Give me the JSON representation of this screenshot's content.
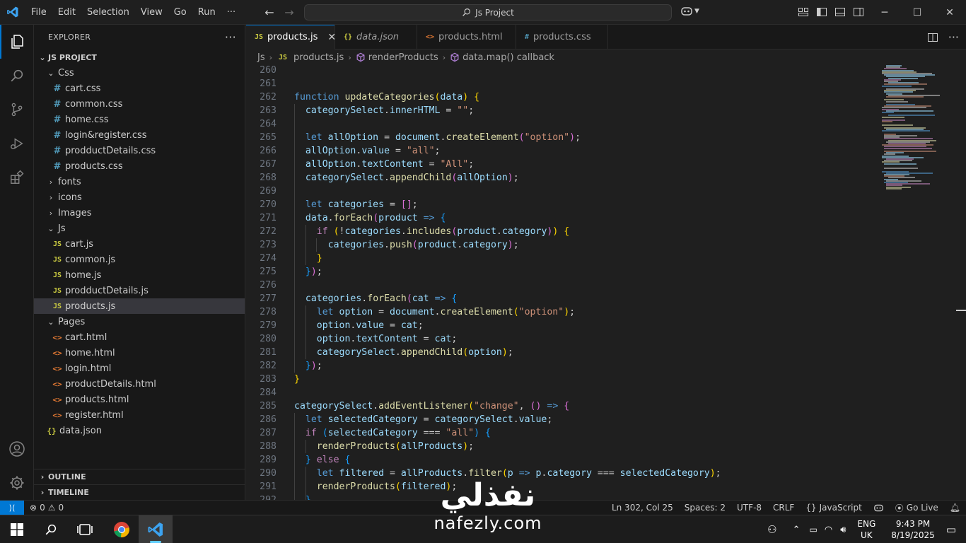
{
  "menu": [
    "File",
    "Edit",
    "Selection",
    "View",
    "Go",
    "Run",
    "···"
  ],
  "command_center": {
    "label": "Js Project"
  },
  "explorer": {
    "header": "EXPLORER",
    "project": "JS PROJECT",
    "tree": [
      {
        "label": "Css",
        "type": "folder-open",
        "depth": 1
      },
      {
        "label": "cart.css",
        "type": "css",
        "depth": 2
      },
      {
        "label": "common.css",
        "type": "css",
        "depth": 2
      },
      {
        "label": "home.css",
        "type": "css",
        "depth": 2
      },
      {
        "label": "login&register.css",
        "type": "css",
        "depth": 2
      },
      {
        "label": "prodductDetails.css",
        "type": "css",
        "depth": 2
      },
      {
        "label": "products.css",
        "type": "css",
        "depth": 2
      },
      {
        "label": "fonts",
        "type": "folder",
        "depth": 1
      },
      {
        "label": "icons",
        "type": "folder",
        "depth": 1
      },
      {
        "label": "Images",
        "type": "folder",
        "depth": 1
      },
      {
        "label": "Js",
        "type": "folder-open",
        "depth": 1
      },
      {
        "label": "cart.js",
        "type": "js",
        "depth": 2
      },
      {
        "label": "common.js",
        "type": "js",
        "depth": 2
      },
      {
        "label": "home.js",
        "type": "js",
        "depth": 2
      },
      {
        "label": "prodductDetails.js",
        "type": "js",
        "depth": 2
      },
      {
        "label": "products.js",
        "type": "js",
        "depth": 2,
        "selected": true
      },
      {
        "label": "Pages",
        "type": "folder-open",
        "depth": 1
      },
      {
        "label": "cart.html",
        "type": "html",
        "depth": 2
      },
      {
        "label": "home.html",
        "type": "html",
        "depth": 2
      },
      {
        "label": "login.html",
        "type": "html",
        "depth": 2
      },
      {
        "label": "productDetails.html",
        "type": "html",
        "depth": 2
      },
      {
        "label": "products.html",
        "type": "html",
        "depth": 2
      },
      {
        "label": "register.html",
        "type": "html",
        "depth": 2
      },
      {
        "label": "data.json",
        "type": "json",
        "depth": 1
      }
    ],
    "outline": "OUTLINE",
    "timeline": "TIMELINE"
  },
  "tabs": [
    {
      "label": "products.js",
      "icon": "JS",
      "kind": "js",
      "active": true
    },
    {
      "label": "data.json",
      "icon": "{}",
      "kind": "json",
      "italic": true
    },
    {
      "label": "products.html",
      "icon": "<>",
      "kind": "html"
    },
    {
      "label": "products.css",
      "icon": "#",
      "kind": "css"
    }
  ],
  "breadcrumbs": {
    "folder": "Js",
    "file": "products.js",
    "symbol1": "renderProducts",
    "symbol2": "data.map() callback"
  },
  "code": {
    "first_line": 260,
    "lines": [
      [],
      [],
      [
        [
          "k",
          "function "
        ],
        [
          "f",
          "updateCategories"
        ],
        [
          "b1",
          "("
        ],
        [
          "v",
          "data"
        ],
        [
          "b1",
          ")"
        ],
        [
          "p",
          " "
        ],
        [
          "b1",
          "{"
        ]
      ],
      [
        [
          "p",
          "  "
        ],
        [
          "v",
          "categorySelect"
        ],
        [
          "p",
          "."
        ],
        [
          "v",
          "innerHTML"
        ],
        [
          "p",
          " = "
        ],
        [
          "s",
          "\"\""
        ],
        [
          "p",
          ";"
        ]
      ],
      [],
      [
        [
          "p",
          "  "
        ],
        [
          "k",
          "let "
        ],
        [
          "v",
          "allOption"
        ],
        [
          "p",
          " = "
        ],
        [
          "v",
          "document"
        ],
        [
          "p",
          "."
        ],
        [
          "f",
          "createElement"
        ],
        [
          "b2",
          "("
        ],
        [
          "s",
          "\"option\""
        ],
        [
          "b2",
          ")"
        ],
        [
          "p",
          ";"
        ]
      ],
      [
        [
          "p",
          "  "
        ],
        [
          "v",
          "allOption"
        ],
        [
          "p",
          "."
        ],
        [
          "v",
          "value"
        ],
        [
          "p",
          " = "
        ],
        [
          "s",
          "\"all\""
        ],
        [
          "p",
          ";"
        ]
      ],
      [
        [
          "p",
          "  "
        ],
        [
          "v",
          "allOption"
        ],
        [
          "p",
          "."
        ],
        [
          "v",
          "textContent"
        ],
        [
          "p",
          " = "
        ],
        [
          "s",
          "\"All\""
        ],
        [
          "p",
          ";"
        ]
      ],
      [
        [
          "p",
          "  "
        ],
        [
          "v",
          "categorySelect"
        ],
        [
          "p",
          "."
        ],
        [
          "f",
          "appendChild"
        ],
        [
          "b2",
          "("
        ],
        [
          "v",
          "allOption"
        ],
        [
          "b2",
          ")"
        ],
        [
          "p",
          ";"
        ]
      ],
      [],
      [
        [
          "p",
          "  "
        ],
        [
          "k",
          "let "
        ],
        [
          "v",
          "categories"
        ],
        [
          "p",
          " = "
        ],
        [
          "b2",
          "[]"
        ],
        [
          "p",
          ";"
        ]
      ],
      [
        [
          "p",
          "  "
        ],
        [
          "v",
          "data"
        ],
        [
          "p",
          "."
        ],
        [
          "f",
          "forEach"
        ],
        [
          "b2",
          "("
        ],
        [
          "v",
          "product"
        ],
        [
          "p",
          " "
        ],
        [
          "k",
          "=>"
        ],
        [
          "p",
          " "
        ],
        [
          "b3",
          "{"
        ]
      ],
      [
        [
          "p",
          "    "
        ],
        [
          "c",
          "if "
        ],
        [
          "b1",
          "("
        ],
        [
          "p",
          "!"
        ],
        [
          "v",
          "categories"
        ],
        [
          "p",
          "."
        ],
        [
          "f",
          "includes"
        ],
        [
          "b2",
          "("
        ],
        [
          "v",
          "product"
        ],
        [
          "p",
          "."
        ],
        [
          "v",
          "category"
        ],
        [
          "b2",
          ")"
        ],
        [
          "b1",
          ")"
        ],
        [
          "p",
          " "
        ],
        [
          "b1",
          "{"
        ]
      ],
      [
        [
          "p",
          "      "
        ],
        [
          "v",
          "categories"
        ],
        [
          "p",
          "."
        ],
        [
          "f",
          "push"
        ],
        [
          "b2",
          "("
        ],
        [
          "v",
          "product"
        ],
        [
          "p",
          "."
        ],
        [
          "v",
          "category"
        ],
        [
          "b2",
          ")"
        ],
        [
          "p",
          ";"
        ]
      ],
      [
        [
          "p",
          "    "
        ],
        [
          "b1",
          "}"
        ]
      ],
      [
        [
          "p",
          "  "
        ],
        [
          "b3",
          "}"
        ],
        [
          "b2",
          ")"
        ],
        [
          "p",
          ";"
        ]
      ],
      [],
      [
        [
          "p",
          "  "
        ],
        [
          "v",
          "categories"
        ],
        [
          "p",
          "."
        ],
        [
          "f",
          "forEach"
        ],
        [
          "b2",
          "("
        ],
        [
          "v",
          "cat"
        ],
        [
          "p",
          " "
        ],
        [
          "k",
          "=>"
        ],
        [
          "p",
          " "
        ],
        [
          "b3",
          "{"
        ]
      ],
      [
        [
          "p",
          "    "
        ],
        [
          "k",
          "let "
        ],
        [
          "v",
          "option"
        ],
        [
          "p",
          " = "
        ],
        [
          "v",
          "document"
        ],
        [
          "p",
          "."
        ],
        [
          "f",
          "createElement"
        ],
        [
          "b1",
          "("
        ],
        [
          "s",
          "\"option\""
        ],
        [
          "b1",
          ")"
        ],
        [
          "p",
          ";"
        ]
      ],
      [
        [
          "p",
          "    "
        ],
        [
          "v",
          "option"
        ],
        [
          "p",
          "."
        ],
        [
          "v",
          "value"
        ],
        [
          "p",
          " = "
        ],
        [
          "v",
          "cat"
        ],
        [
          "p",
          ";"
        ]
      ],
      [
        [
          "p",
          "    "
        ],
        [
          "v",
          "option"
        ],
        [
          "p",
          "."
        ],
        [
          "v",
          "textContent"
        ],
        [
          "p",
          " = "
        ],
        [
          "v",
          "cat"
        ],
        [
          "p",
          ";"
        ]
      ],
      [
        [
          "p",
          "    "
        ],
        [
          "v",
          "categorySelect"
        ],
        [
          "p",
          "."
        ],
        [
          "f",
          "appendChild"
        ],
        [
          "b1",
          "("
        ],
        [
          "v",
          "option"
        ],
        [
          "b1",
          ")"
        ],
        [
          "p",
          ";"
        ]
      ],
      [
        [
          "p",
          "  "
        ],
        [
          "b3",
          "}"
        ],
        [
          "b2",
          ")"
        ],
        [
          "p",
          ";"
        ]
      ],
      [
        [
          "b1",
          "}"
        ]
      ],
      [],
      [
        [
          "v",
          "categorySelect"
        ],
        [
          "p",
          "."
        ],
        [
          "f",
          "addEventListener"
        ],
        [
          "b1",
          "("
        ],
        [
          "s",
          "\"change\""
        ],
        [
          "p",
          ", "
        ],
        [
          "b2",
          "()"
        ],
        [
          "p",
          " "
        ],
        [
          "k",
          "=>"
        ],
        [
          "p",
          " "
        ],
        [
          "b2",
          "{"
        ]
      ],
      [
        [
          "p",
          "  "
        ],
        [
          "k",
          "let "
        ],
        [
          "v",
          "selectedCategory"
        ],
        [
          "p",
          " = "
        ],
        [
          "v",
          "categorySelect"
        ],
        [
          "p",
          "."
        ],
        [
          "v",
          "value"
        ],
        [
          "p",
          ";"
        ]
      ],
      [
        [
          "p",
          "  "
        ],
        [
          "c",
          "if "
        ],
        [
          "b3",
          "("
        ],
        [
          "v",
          "selectedCategory"
        ],
        [
          "p",
          " === "
        ],
        [
          "s",
          "\"all\""
        ],
        [
          "b3",
          ")"
        ],
        [
          "p",
          " "
        ],
        [
          "b3",
          "{"
        ]
      ],
      [
        [
          "p",
          "    "
        ],
        [
          "f",
          "renderProducts"
        ],
        [
          "b1",
          "("
        ],
        [
          "v",
          "allProducts"
        ],
        [
          "b1",
          ")"
        ],
        [
          "p",
          ";"
        ]
      ],
      [
        [
          "p",
          "  "
        ],
        [
          "b3",
          "}"
        ],
        [
          "p",
          " "
        ],
        [
          "c",
          "else "
        ],
        [
          "b3",
          "{"
        ]
      ],
      [
        [
          "p",
          "    "
        ],
        [
          "k",
          "let "
        ],
        [
          "v",
          "filtered"
        ],
        [
          "p",
          " = "
        ],
        [
          "v",
          "allProducts"
        ],
        [
          "p",
          "."
        ],
        [
          "f",
          "filter"
        ],
        [
          "b1",
          "("
        ],
        [
          "v",
          "p"
        ],
        [
          "p",
          " "
        ],
        [
          "k",
          "=>"
        ],
        [
          "p",
          " "
        ],
        [
          "v",
          "p"
        ],
        [
          "p",
          "."
        ],
        [
          "v",
          "category"
        ],
        [
          "p",
          " === "
        ],
        [
          "v",
          "selectedCategory"
        ],
        [
          "b1",
          ")"
        ],
        [
          "p",
          ";"
        ]
      ],
      [
        [
          "p",
          "    "
        ],
        [
          "f",
          "renderProducts"
        ],
        [
          "b1",
          "("
        ],
        [
          "v",
          "filtered"
        ],
        [
          "b1",
          ")"
        ],
        [
          "p",
          ";"
        ]
      ],
      [
        [
          "p",
          "  "
        ],
        [
          "b3",
          "}"
        ]
      ]
    ]
  },
  "status": {
    "errors": "0",
    "warnings": "0",
    "position": "Ln 302, Col 25",
    "spaces": "Spaces: 2",
    "encoding": "UTF-8",
    "eol": "CRLF",
    "language": "JavaScript",
    "golive": "Go Live"
  },
  "taskbar": {
    "lang_top": "ENG",
    "lang_bottom": "UK",
    "time": "9:43 PM",
    "date": "8/19/2025"
  },
  "watermark": {
    "arabic": "نفذلي",
    "latin": "nafezly.com"
  },
  "colors": {
    "accent": "#0078d4",
    "editor_bg": "#1f1f1f",
    "sidebar_bg": "#181818"
  }
}
